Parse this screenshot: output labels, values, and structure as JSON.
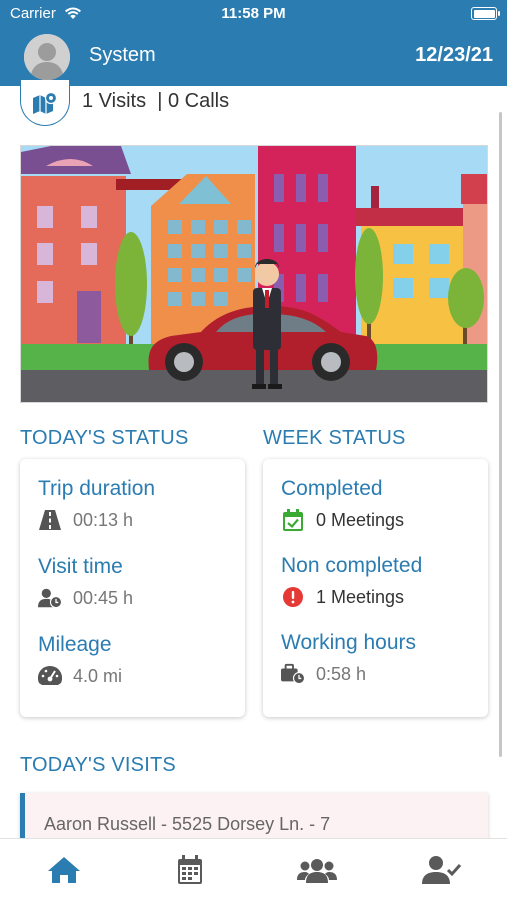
{
  "status_bar": {
    "carrier": "Carrier",
    "time": "11:58 PM"
  },
  "header": {
    "name": "System",
    "date": "12/23/21"
  },
  "summary": {
    "counts_text": "1 Visits  | 0 Calls"
  },
  "today_status": {
    "title": "TODAY'S STATUS",
    "items": [
      {
        "label": "Trip duration",
        "value": "00:13 h",
        "icon": "road-icon"
      },
      {
        "label": "Visit time",
        "value": "00:45 h",
        "icon": "user-clock-icon"
      },
      {
        "label": "Mileage",
        "value": "4.0 mi",
        "icon": "speedometer-icon"
      }
    ]
  },
  "week_status": {
    "title": "WEEK STATUS",
    "items": [
      {
        "label": "Completed",
        "value": "0 Meetings",
        "icon": "calendar-check-icon"
      },
      {
        "label": "Non completed",
        "value": "1 Meetings",
        "icon": "exclamation-circle-icon"
      },
      {
        "label": "Working hours",
        "value": "0:58 h",
        "icon": "briefcase-clock-icon"
      }
    ]
  },
  "visits": {
    "title": "TODAY'S VISITS",
    "items": [
      {
        "text": "Aaron Russell - 5525 Dorsey Ln. - 7"
      }
    ]
  },
  "tabs": [
    {
      "name": "home",
      "icon": "home-icon",
      "active": true
    },
    {
      "name": "calendar",
      "icon": "calendar-icon",
      "active": false
    },
    {
      "name": "contacts",
      "icon": "users-icon",
      "active": false
    },
    {
      "name": "profile",
      "icon": "user-check-icon",
      "active": false
    }
  ],
  "colors": {
    "primary": "#2b7cb1",
    "success": "#3aaa35",
    "danger": "#e53935",
    "icon_gray": "#555555"
  }
}
